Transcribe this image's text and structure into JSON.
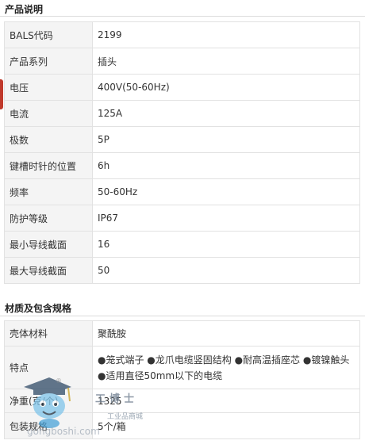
{
  "sections": {
    "product": {
      "title": "产品说明",
      "rows": [
        {
          "key": "BALS代码",
          "value": "2199"
        },
        {
          "key": "产品系列",
          "value": "插头"
        },
        {
          "key": "电压",
          "value": "400V(50-60Hz)"
        },
        {
          "key": "电流",
          "value": "125A"
        },
        {
          "key": "极数",
          "value": "5P"
        },
        {
          "key": "键槽时针的位置",
          "value": "6h"
        },
        {
          "key": "频率",
          "value": "50-60Hz"
        },
        {
          "key": "防护等级",
          "value": "IP67"
        },
        {
          "key": "最小导线截面",
          "value": "16"
        },
        {
          "key": "最大导线截面",
          "value": "50"
        }
      ]
    },
    "material": {
      "title": "材质及包含规格",
      "rows": [
        {
          "key": "壳体材料",
          "value": "聚酰胺"
        },
        {
          "key": "特点",
          "value": "●笼式端子 ●龙爪电缆竖固结构 ●耐高温插座芯 ●镀镍触头 ●适用直径50mm以下的电缆"
        },
        {
          "key": "净重(克/个)",
          "value": "1325"
        },
        {
          "key": "包装规格",
          "value": "5个/箱"
        }
      ]
    }
  },
  "watermark": {
    "brand": "工博士",
    "subtitle": "工业品商城",
    "url": "gongboshi.com",
    "registered": "®"
  }
}
